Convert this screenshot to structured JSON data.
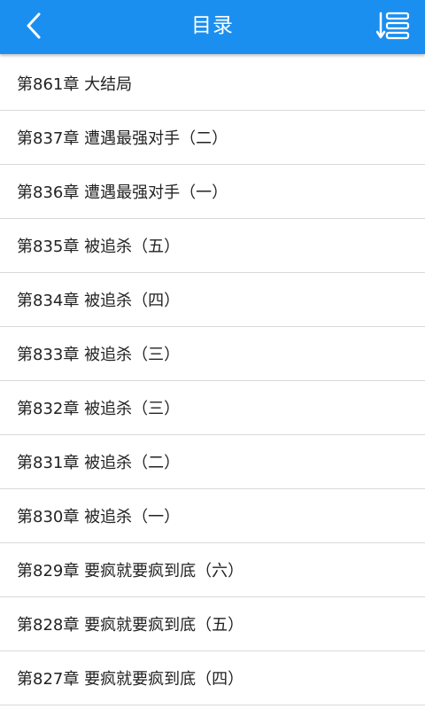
{
  "header": {
    "title": "目录",
    "back_icon": "chevron-left-icon",
    "sort_icon": "sort-list-icon",
    "accent_color": "#1b8ff0"
  },
  "chapters": [
    {
      "label": "第861章 大结局"
    },
    {
      "label": "第837章 遭遇最强对手（二）"
    },
    {
      "label": "第836章 遭遇最强对手（一）"
    },
    {
      "label": "第835章 被追杀（五）"
    },
    {
      "label": "第834章 被追杀（四）"
    },
    {
      "label": "第833章 被追杀（三）"
    },
    {
      "label": "第832章 被追杀（三）"
    },
    {
      "label": "第831章 被追杀（二）"
    },
    {
      "label": "第830章 被追杀（一）"
    },
    {
      "label": "第829章 要疯就要疯到底（六）"
    },
    {
      "label": "第828章 要疯就要疯到底（五）"
    },
    {
      "label": "第827章 要疯就要疯到底（四）"
    }
  ]
}
